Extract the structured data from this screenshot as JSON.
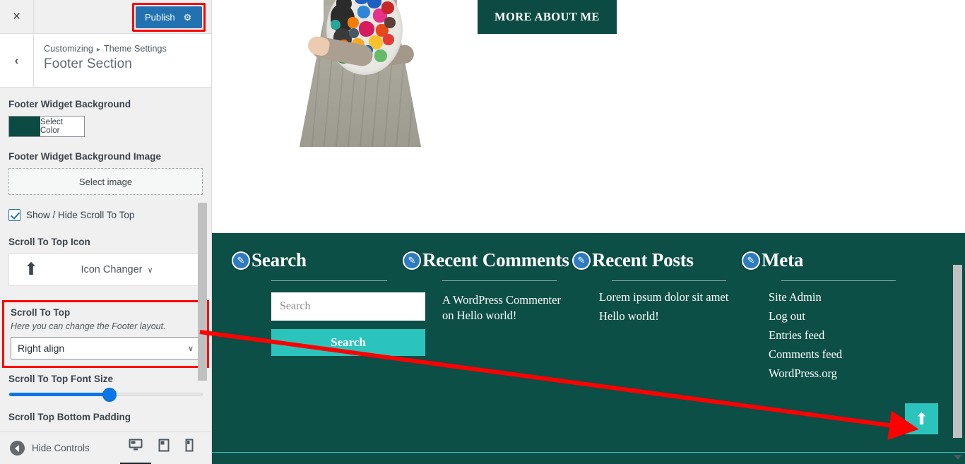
{
  "customizer": {
    "close_label": "×",
    "publish_label": "Publish",
    "gear_icon": "⚙",
    "back_label": "‹",
    "breadcrumb_root": "Customizing",
    "breadcrumb_sep": "▸",
    "breadcrumb_parent": "Theme Settings",
    "section_title": "Footer Section",
    "controls": {
      "widget_bg_label": "Footer Widget Background",
      "widget_bg_color": "#0b4b44",
      "select_color_label": "Select Color",
      "widget_bg_image_label": "Footer Widget Background Image",
      "select_image_label": "Select image",
      "show_hide_label": "Show / Hide Scroll To Top",
      "show_hide_checked": true,
      "scroll_icon_label": "Scroll To Top Icon",
      "icon_glyph": "⬆",
      "icon_changer_label": "Icon Changer",
      "caret_glyph": "∨",
      "highlight": {
        "title": "Scroll To Top",
        "description": "Here you can change the Footer layout.",
        "select_value": "Right align"
      },
      "font_size_label": "Scroll To Top Font Size",
      "font_size_percent": 52,
      "bottom_padding_label": "Scroll Top Bottom Padding"
    },
    "footer_bar": {
      "hide_controls_label": "Hide Controls",
      "devices": [
        {
          "name": "desktop",
          "active": true
        },
        {
          "name": "tablet",
          "active": false
        },
        {
          "name": "mobile",
          "active": false
        }
      ]
    }
  },
  "preview": {
    "about_button_label": "MORE ABOUT ME",
    "site_footer": {
      "background_color": "#0b4f47",
      "accent_color": "#2bc4bd",
      "columns": [
        {
          "title": "Search",
          "edit_icon": "✎",
          "search_placeholder": "Search",
          "search_button_label": "Search"
        },
        {
          "title": "Recent Comments",
          "edit_icon": "✎",
          "comment_author": "A WordPress Commenter",
          "comment_on": "on",
          "comment_post": "Hello world!"
        },
        {
          "title": "Recent Posts",
          "edit_icon": "✎",
          "items": [
            "Lorem ipsum dolor sit amet",
            "Hello world!"
          ]
        },
        {
          "title": "Meta",
          "edit_icon": "✎",
          "items": [
            "Site Admin",
            "Log out",
            "Entries feed",
            "Comments feed",
            "WordPress.org"
          ]
        }
      ],
      "scroll_top_icon": "⬆"
    }
  },
  "annotation": {
    "arrow_color": "#ff0000",
    "highlight_color": "#ff0000"
  }
}
